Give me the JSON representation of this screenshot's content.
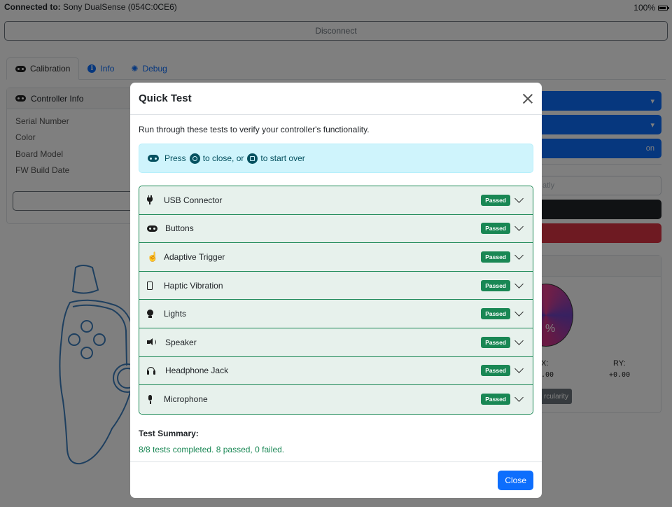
{
  "status": {
    "connected_label": "Connected to:",
    "device": "Sony DualSense (054C:0CE6)",
    "battery_text": "100%",
    "battery_level": 1.0
  },
  "disconnect_label": "Disconnect",
  "tabs": [
    {
      "label": "Calibration",
      "icon": "gamepad-icon"
    },
    {
      "label": "Info",
      "icon": "info-icon"
    },
    {
      "label": "Debug",
      "icon": "bug-icon"
    }
  ],
  "controller_info": {
    "title": "Controller Info",
    "rows": [
      "Serial Number",
      "Color",
      "Board Model",
      "FW Build Date"
    ]
  },
  "right_panel": {
    "outline_btn_partial": "atly",
    "blue_btn_partial": "on",
    "stick_pct": "%",
    "rx_label": "X:",
    "ry_label": "RY:",
    "rx_value": ".00",
    "ry_value": "+0.00",
    "circ_btn_partial": "rcularity"
  },
  "modal": {
    "title": "Quick Test",
    "intro": "Run through these tests to verify your controller's functionality.",
    "hint": {
      "press": "Press",
      "to_close": "to close, or",
      "to_start_over": "to start over"
    },
    "tests": [
      {
        "label": "USB Connector",
        "status": "Passed",
        "icon": "plug-icon"
      },
      {
        "label": "Buttons",
        "status": "Passed",
        "icon": "gamepad-icon"
      },
      {
        "label": "Adaptive Trigger",
        "status": "Passed",
        "icon": "hand-pointer-icon"
      },
      {
        "label": "Haptic Vibration",
        "status": "Passed",
        "icon": "mobile-icon"
      },
      {
        "label": "Lights",
        "status": "Passed",
        "icon": "lightbulb-icon"
      },
      {
        "label": "Speaker",
        "status": "Passed",
        "icon": "speaker-icon"
      },
      {
        "label": "Headphone Jack",
        "status": "Passed",
        "icon": "headphones-icon"
      },
      {
        "label": "Microphone",
        "status": "Passed",
        "icon": "microphone-icon"
      }
    ],
    "summary_title": "Test Summary:",
    "summary_text": "8/8 tests completed. 8 passed, 0 failed.",
    "close_label": "Close"
  },
  "colors": {
    "primary": "#0d6efd",
    "success": "#198754",
    "info_bg": "#cff4fc",
    "danger": "#dc3545"
  }
}
